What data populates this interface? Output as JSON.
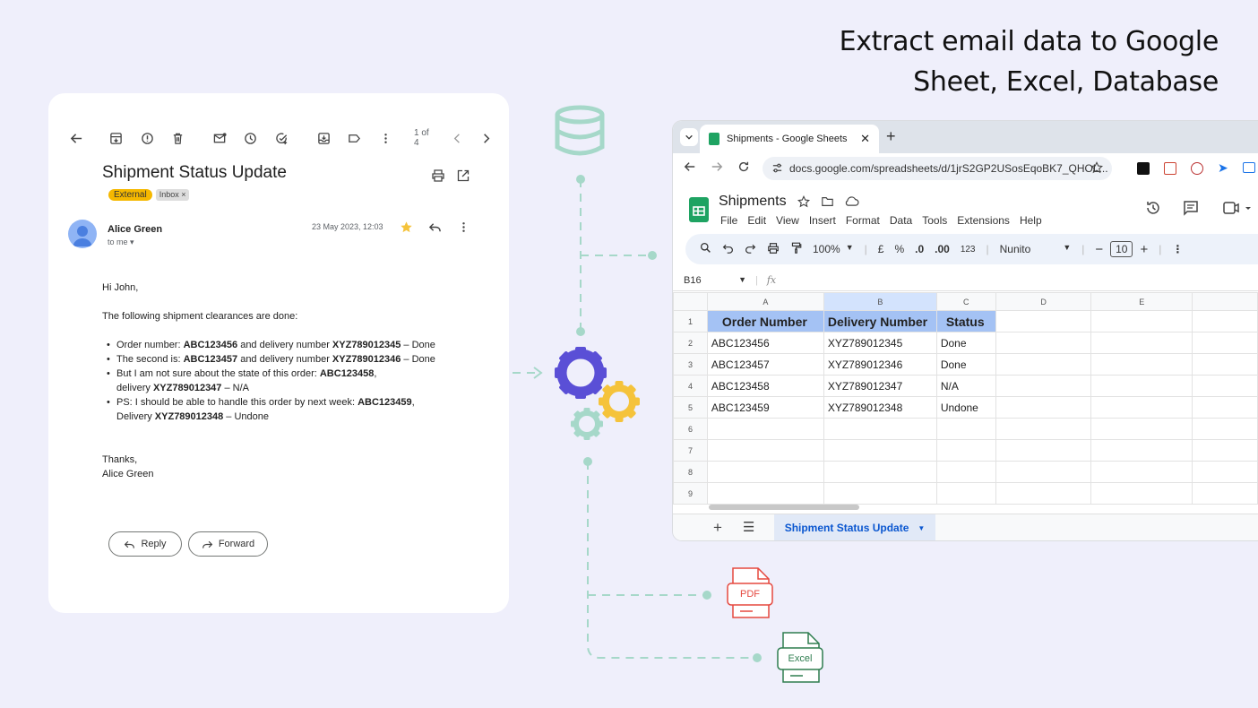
{
  "headline": {
    "line1": "Extract email data to Google",
    "line2": "Sheet, Excel, Database"
  },
  "email": {
    "pager": "1 of 4",
    "subject": "Shipment Status Update",
    "tag_external": "External",
    "tag_inbox": "Inbox ×",
    "sender": "Alice Green",
    "to": "to me ▾",
    "date": "23 May 2023, 12:03",
    "greeting": "Hi John,",
    "intro": "The following shipment clearances are done:",
    "items": [
      {
        "pre": "Order number: ",
        "b1": "ABC123456",
        "mid": " and delivery number ",
        "b2": "XYZ789012345",
        "post": " – Done"
      },
      {
        "pre": "The second is: ",
        "b1": "ABC123457",
        "mid": " and delivery number ",
        "b2": "XYZ789012346",
        "post": " – Done"
      },
      {
        "pre": "But I am not sure about the state of this order: ",
        "b1": "ABC123458",
        "mid": ",\ndelivery ",
        "b2": "XYZ789012347",
        "post": " – N/A"
      },
      {
        "pre": "PS: I should be able to handle this order by next week: ",
        "b1": "ABC123459",
        "mid": ",\nDelivery ",
        "b2": "XYZ789012348",
        "post": " – Undone"
      }
    ],
    "signoff": "Thanks,",
    "signature": "Alice Green",
    "reply_label": "Reply",
    "forward_label": "Forward"
  },
  "files": {
    "pdf_label": "PDF",
    "excel_label": "Excel"
  },
  "colors": {
    "accent_purple": "#5a4fd6",
    "accent_yellow": "#f5c33b",
    "accent_teal": "#a6d8c9",
    "pdf_red": "#e5483f",
    "excel_green": "#2e7d4f"
  },
  "sheets": {
    "tab_title": "Shipments - Google Sheets",
    "url": "docs.google.com/spreadsheets/d/1jrS2GP2USosEqoBK7_QHOL...",
    "doc_title": "Shipments",
    "menus": [
      "File",
      "Edit",
      "View",
      "Insert",
      "Format",
      "Data",
      "Tools",
      "Extensions",
      "Help"
    ],
    "zoom": "100%",
    "currency": "£",
    "percent": "%",
    "dec_less": ".0",
    "dec_more": ".00",
    "num_fmt": "123",
    "font": "Nunito",
    "font_size": "10",
    "cell_ref": "B16",
    "fx": "fx",
    "columns": [
      "A",
      "B",
      "C",
      "D",
      "E"
    ],
    "headers": [
      "Order Number",
      "Delivery Number",
      "Status"
    ],
    "rows": [
      [
        "ABC123456",
        "XYZ789012345",
        "Done"
      ],
      [
        "ABC123457",
        "XYZ789012346",
        "Done"
      ],
      [
        "ABC123458",
        "XYZ789012347",
        "N/A"
      ],
      [
        "ABC123459",
        "XYZ789012348",
        "Undone"
      ]
    ],
    "row_numbers": [
      "1",
      "2",
      "3",
      "4",
      "5",
      "6",
      "7",
      "8",
      "9"
    ],
    "sheet_tab": "Shipment Status Update"
  }
}
